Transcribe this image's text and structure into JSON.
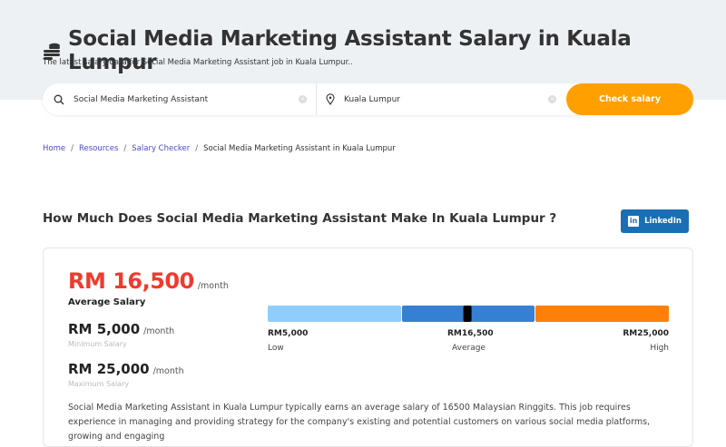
{
  "header": {
    "title": "Social Media Marketing Assistant Salary in Kuala Lumpur",
    "subtitle": "The latest salary data for Social Media Marketing Assistant job in Kuala Lumpur.."
  },
  "search": {
    "job_value": "Social Media Marketing Assistant",
    "location_value": "Kuala Lumpur",
    "button": "Check salary"
  },
  "breadcrumb": [
    "Home",
    "Resources",
    "Salary Checker",
    "Social Media Marketing Assistant in Kuala Lumpur"
  ],
  "section": {
    "heading": "How Much Does Social Media Marketing Assistant Make In Kuala Lumpur ?",
    "linkedin": "LinkedIn",
    "linkedin_logo": "in"
  },
  "salary": {
    "average": "RM 16,500",
    "average_label": "Average Salary",
    "minimum": "RM 5,000",
    "minimum_label": "Minimum Salary",
    "maximum": "RM 25,000",
    "maximum_label": "Maximum Salary",
    "unit": "/month",
    "bar": {
      "low_value": "RM5,000",
      "low_label": "Low",
      "avg_value": "RM16,500",
      "avg_label": "Average",
      "high_value": "RM25,000",
      "high_label": "High"
    },
    "colors": {
      "low": "#8fcdfc",
      "mid": "#3680d4",
      "high": "#ff8008"
    }
  },
  "description": "Social Media Marketing Assistant in Kuala Lumpur typically earns an average salary of 16500 Malaysian Ringgits. This job requires experience in managing and providing strategy for the company's existing and potential customers on various social media platforms, growing and engaging"
}
